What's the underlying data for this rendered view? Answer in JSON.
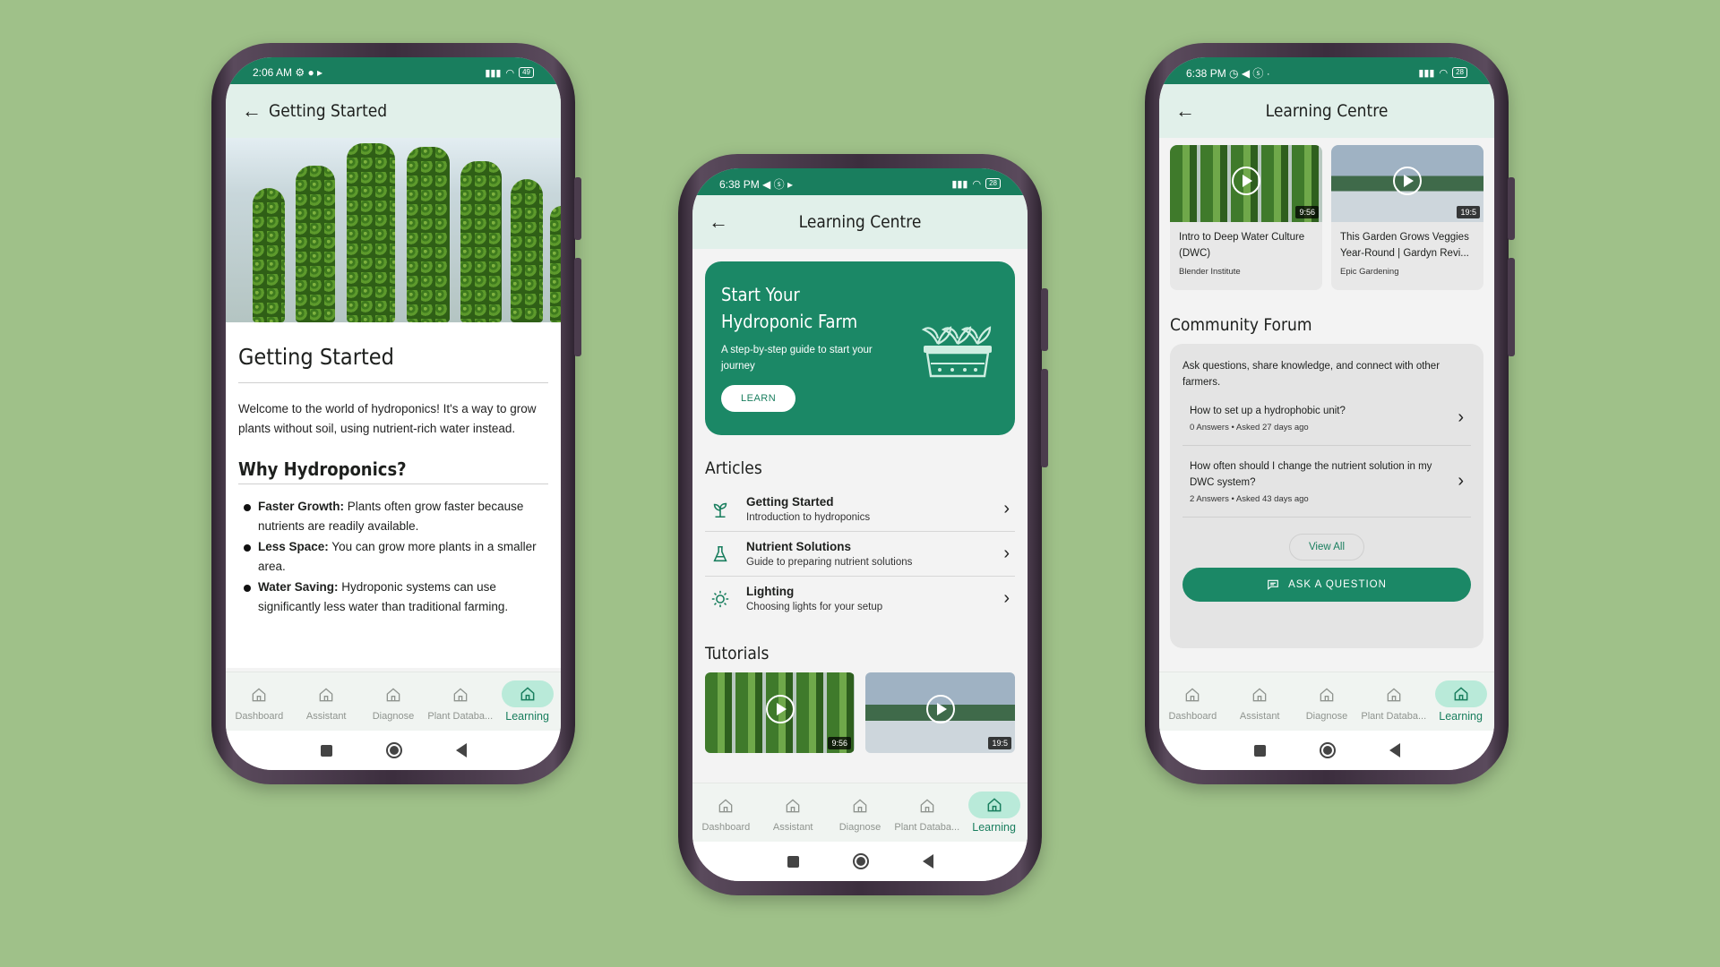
{
  "nav_items": [
    "Dashboard",
    "Assistant",
    "Diagnose",
    "Plant Databa...",
    "Learning"
  ],
  "phone1": {
    "status": {
      "time": "2:06 AM",
      "icons": "⚙ ● ▸",
      "battery": "49"
    },
    "appbar_title": "Getting Started",
    "heading": "Getting Started",
    "intro": "Welcome to the world of hydroponics! It's a way to grow plants without soil, using nutrient-rich water instead.",
    "subheading": "Why Hydroponics?",
    "bullets": [
      {
        "bold": "Faster Growth:",
        "text": " Plants often grow faster because nutrients are readily available."
      },
      {
        "bold": "Less Space:",
        "text": " You can grow more plants in a smaller area."
      },
      {
        "bold": "Water Saving:",
        "text": " Hydroponic systems can use significantly less water than traditional farming."
      }
    ]
  },
  "phone2": {
    "status": {
      "time": "6:38 PM",
      "icons": "◀ ⓢ ▸",
      "battery": "28"
    },
    "appbar_title": "Learning Centre",
    "promo": {
      "title": "Start Your Hydroponic Farm",
      "subtitle": "A step-by-step guide to start your journey",
      "button": "LEARN"
    },
    "articles_title": "Articles",
    "articles": [
      {
        "title": "Getting Started",
        "subtitle": "Introduction to hydroponics",
        "icon": "sprout-icon"
      },
      {
        "title": "Nutrient Solutions",
        "subtitle": "Guide to preparing nutrient solutions",
        "icon": "flask-icon"
      },
      {
        "title": "Lighting",
        "subtitle": "Choosing lights for your setup",
        "icon": "sun-icon"
      }
    ],
    "tutorials_title": "Tutorials",
    "tutorials": [
      {
        "duration": "9:56"
      },
      {
        "duration": "19:5"
      }
    ]
  },
  "phone3": {
    "status": {
      "time": "6:38 PM",
      "icons": "◷ ◀ ⓢ ·",
      "battery": "28"
    },
    "appbar_title": "Learning Centre",
    "videos": [
      {
        "title": "Intro to Deep Water Culture (DWC)",
        "channel": "Blender Institute",
        "duration": "9:56"
      },
      {
        "title": "This Garden Grows Veggies Year-Round | Gardyn Revi...",
        "channel": "Epic Gardening",
        "duration": "19:5"
      }
    ],
    "forum_title": "Community Forum",
    "forum_intro": "Ask questions, share knowledge, and connect with other farmers.",
    "questions": [
      {
        "title": "How to set up a hydrophobic unit?",
        "meta": "0 Answers • Asked 27 days ago"
      },
      {
        "title": "How often should I change the nutrient solution in my DWC system?",
        "meta": "2 Answers • Asked 43 days ago"
      }
    ],
    "view_all": "View All",
    "ask_button": "ASK A QUESTION"
  },
  "colors": {
    "background": "#9fc189",
    "primary": "#1b8866",
    "appbar": "#e1f0ea",
    "active_nav": "#b9ead9"
  }
}
